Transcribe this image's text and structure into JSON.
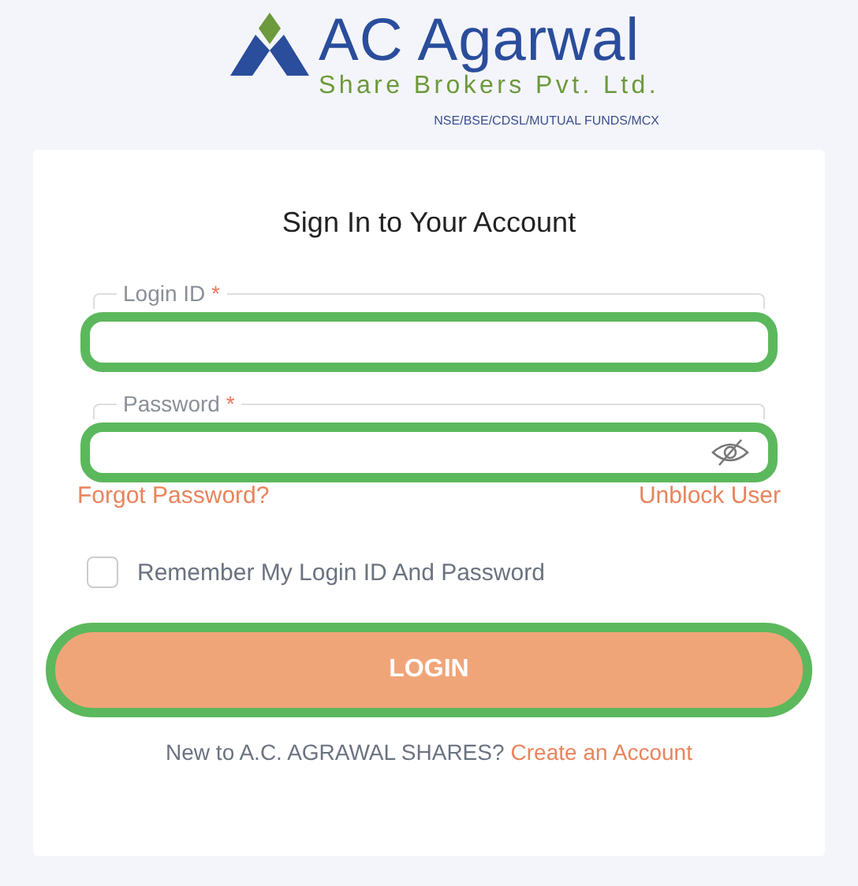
{
  "logo": {
    "name": "AC Agarwal",
    "subtitle": "Share Brokers Pvt. Ltd.",
    "tagline": "NSE/BSE/CDSL/MUTUAL FUNDS/MCX"
  },
  "form": {
    "title": "Sign In to Your Account",
    "fields": [
      {
        "kind": "text",
        "label": "Login ID",
        "required_mark": "*",
        "highlighted": true
      },
      {
        "kind": "password",
        "label": "Password",
        "required_mark": "*",
        "highlighted": true
      }
    ],
    "links": [
      "Forgot Password?",
      "Unblock User"
    ],
    "remember": {
      "label": "Remember My Login ID And Password",
      "checked": false
    },
    "login_button": {
      "label": "LOGIN",
      "highlighted": true
    },
    "signup": {
      "text": "New to A.C. AGRAWAL SHARES?",
      "link": "Create an Account"
    }
  }
}
